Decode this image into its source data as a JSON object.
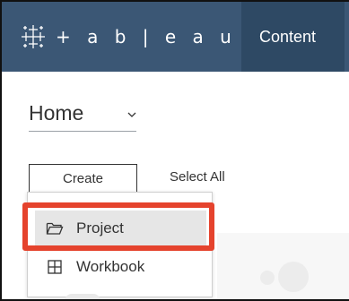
{
  "header": {
    "brand": "+ a b | e a u",
    "content_tab": "Content",
    "colors": {
      "bar": "#3b5775",
      "active_tab": "#2e4964"
    },
    "logo_icon": "tableau-logo-icon"
  },
  "home_select": {
    "value": "Home",
    "icon": "chevron-down-icon"
  },
  "toolbar": {
    "create_label": "Create",
    "select_all_label": "Select All"
  },
  "create_menu": {
    "items": [
      {
        "label": "Project",
        "icon": "folder-icon"
      },
      {
        "label": "Workbook",
        "icon": "grid-icon"
      }
    ],
    "highlight_color": "#e5432d"
  }
}
